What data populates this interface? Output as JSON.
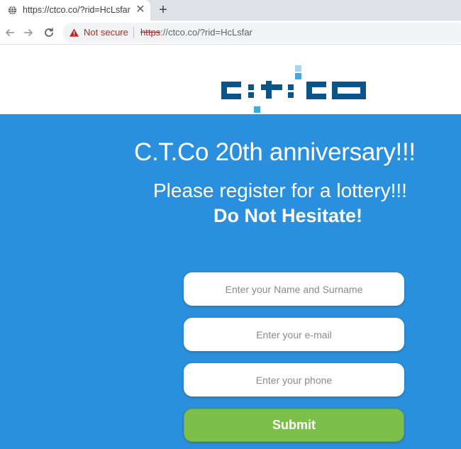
{
  "browser": {
    "tab": {
      "title": "https://ctco.co/?rid=HcLsfar",
      "favicon": "globe-icon",
      "close_glyph": "✕"
    },
    "new_tab_glyph": "+",
    "address_bar": {
      "security_label": "Not secure",
      "security_icon": "warning-triangle-icon",
      "url_scheme": "https",
      "url_rest": "://ctco.co/?rid=HcLsfar"
    }
  },
  "page": {
    "logo_alt": "c:t:co",
    "headline": "C.T.Co 20th anniversary!!!",
    "subline": "Please register for a lottery!!!",
    "emphasis": "Do Not Hesitate!",
    "form": {
      "name_placeholder": "Enter your Name and Surname",
      "email_placeholder": "Enter your e-mail",
      "phone_placeholder": "Enter your phone",
      "submit_label": "Submit"
    }
  },
  "colors": {
    "hero_bg": "#2a8fdc",
    "submit_bg": "#7cc04b",
    "logo_dark": "#0b5489",
    "logo_light": "#3fa9e0",
    "warning_red": "#c5221f"
  }
}
